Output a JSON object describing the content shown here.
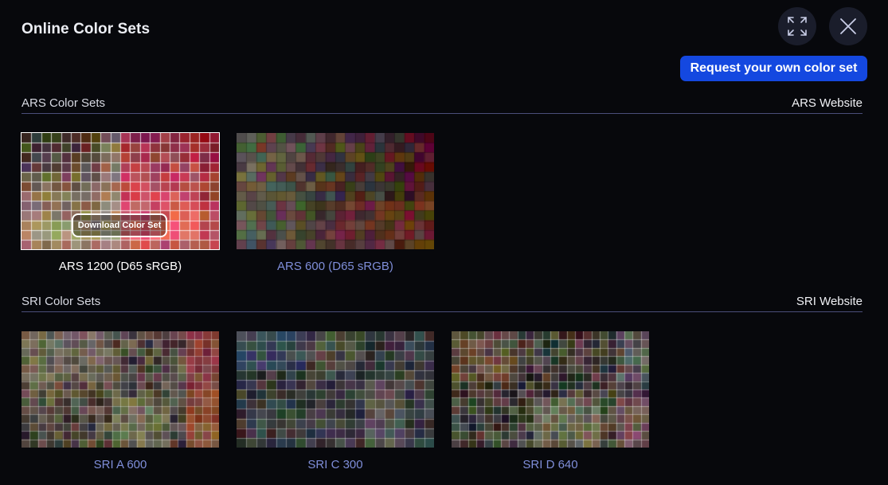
{
  "title": "Online Color Sets",
  "icons": {
    "expand": "expand-icon",
    "close": "close-icon"
  },
  "request_button": "Request your own color set",
  "colors": {
    "accent": "#1448e0",
    "link": "#7f8ed9",
    "divider": "#4a4e7a",
    "background": "#07080c"
  },
  "sections": [
    {
      "label": "ARS Color Sets",
      "link": "ARS Website",
      "sets": [
        {
          "name": "ARS 1200 (D65 sRGB)",
          "selected": true,
          "download_label": "Download Color Set"
        },
        {
          "name": "ARS 600 (D65 sRGB)",
          "selected": false
        }
      ]
    },
    {
      "label": "SRI Color Sets",
      "link": "SRI Website",
      "sets": [
        {
          "name": "SRI A 600",
          "selected": false
        },
        {
          "name": "SRI C 300",
          "selected": false
        },
        {
          "name": "SRI D 640",
          "selected": false
        }
      ]
    }
  ]
}
